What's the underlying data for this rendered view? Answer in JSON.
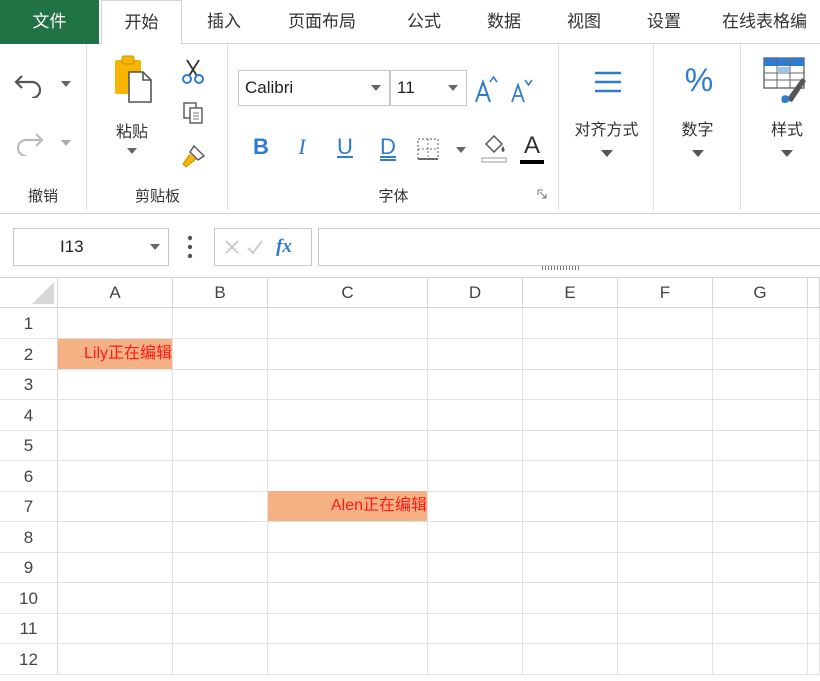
{
  "tabs": [
    {
      "label": "文件"
    },
    {
      "label": "开始"
    },
    {
      "label": "插入"
    },
    {
      "label": "页面布局"
    },
    {
      "label": "公式"
    },
    {
      "label": "数据"
    },
    {
      "label": "视图"
    },
    {
      "label": "设置"
    },
    {
      "label": "在线表格编"
    }
  ],
  "ribbon": {
    "undo_group_label": "撤销",
    "clipboard": {
      "paste_label": "粘贴",
      "group_label": "剪贴板"
    },
    "font": {
      "font_name": "Calibri",
      "font_size": "11",
      "group_label": "字体",
      "bold": "B",
      "italic": "I",
      "underline": "U",
      "double_underline": "D",
      "font_color_glyph": "A",
      "font_color": "#000000"
    },
    "align_label": "对齐方式",
    "number_label": "数字",
    "number_glyph": "%",
    "style_label": "样式"
  },
  "formula_bar": {
    "name_box": "I13",
    "fx": "fx",
    "formula": ""
  },
  "sheet": {
    "columns": [
      "A",
      "B",
      "C",
      "D",
      "E",
      "F",
      "G"
    ],
    "rows": [
      "1",
      "2",
      "3",
      "4",
      "5",
      "6",
      "7",
      "8",
      "9",
      "10",
      "11",
      "12"
    ],
    "cells": [
      {
        "ref": "A2",
        "text": "Lily正在编辑"
      },
      {
        "ref": "C7",
        "text": "Alen正在编辑"
      }
    ],
    "highlight_color": "#f4b183",
    "text_color": "#ff1a1a"
  }
}
